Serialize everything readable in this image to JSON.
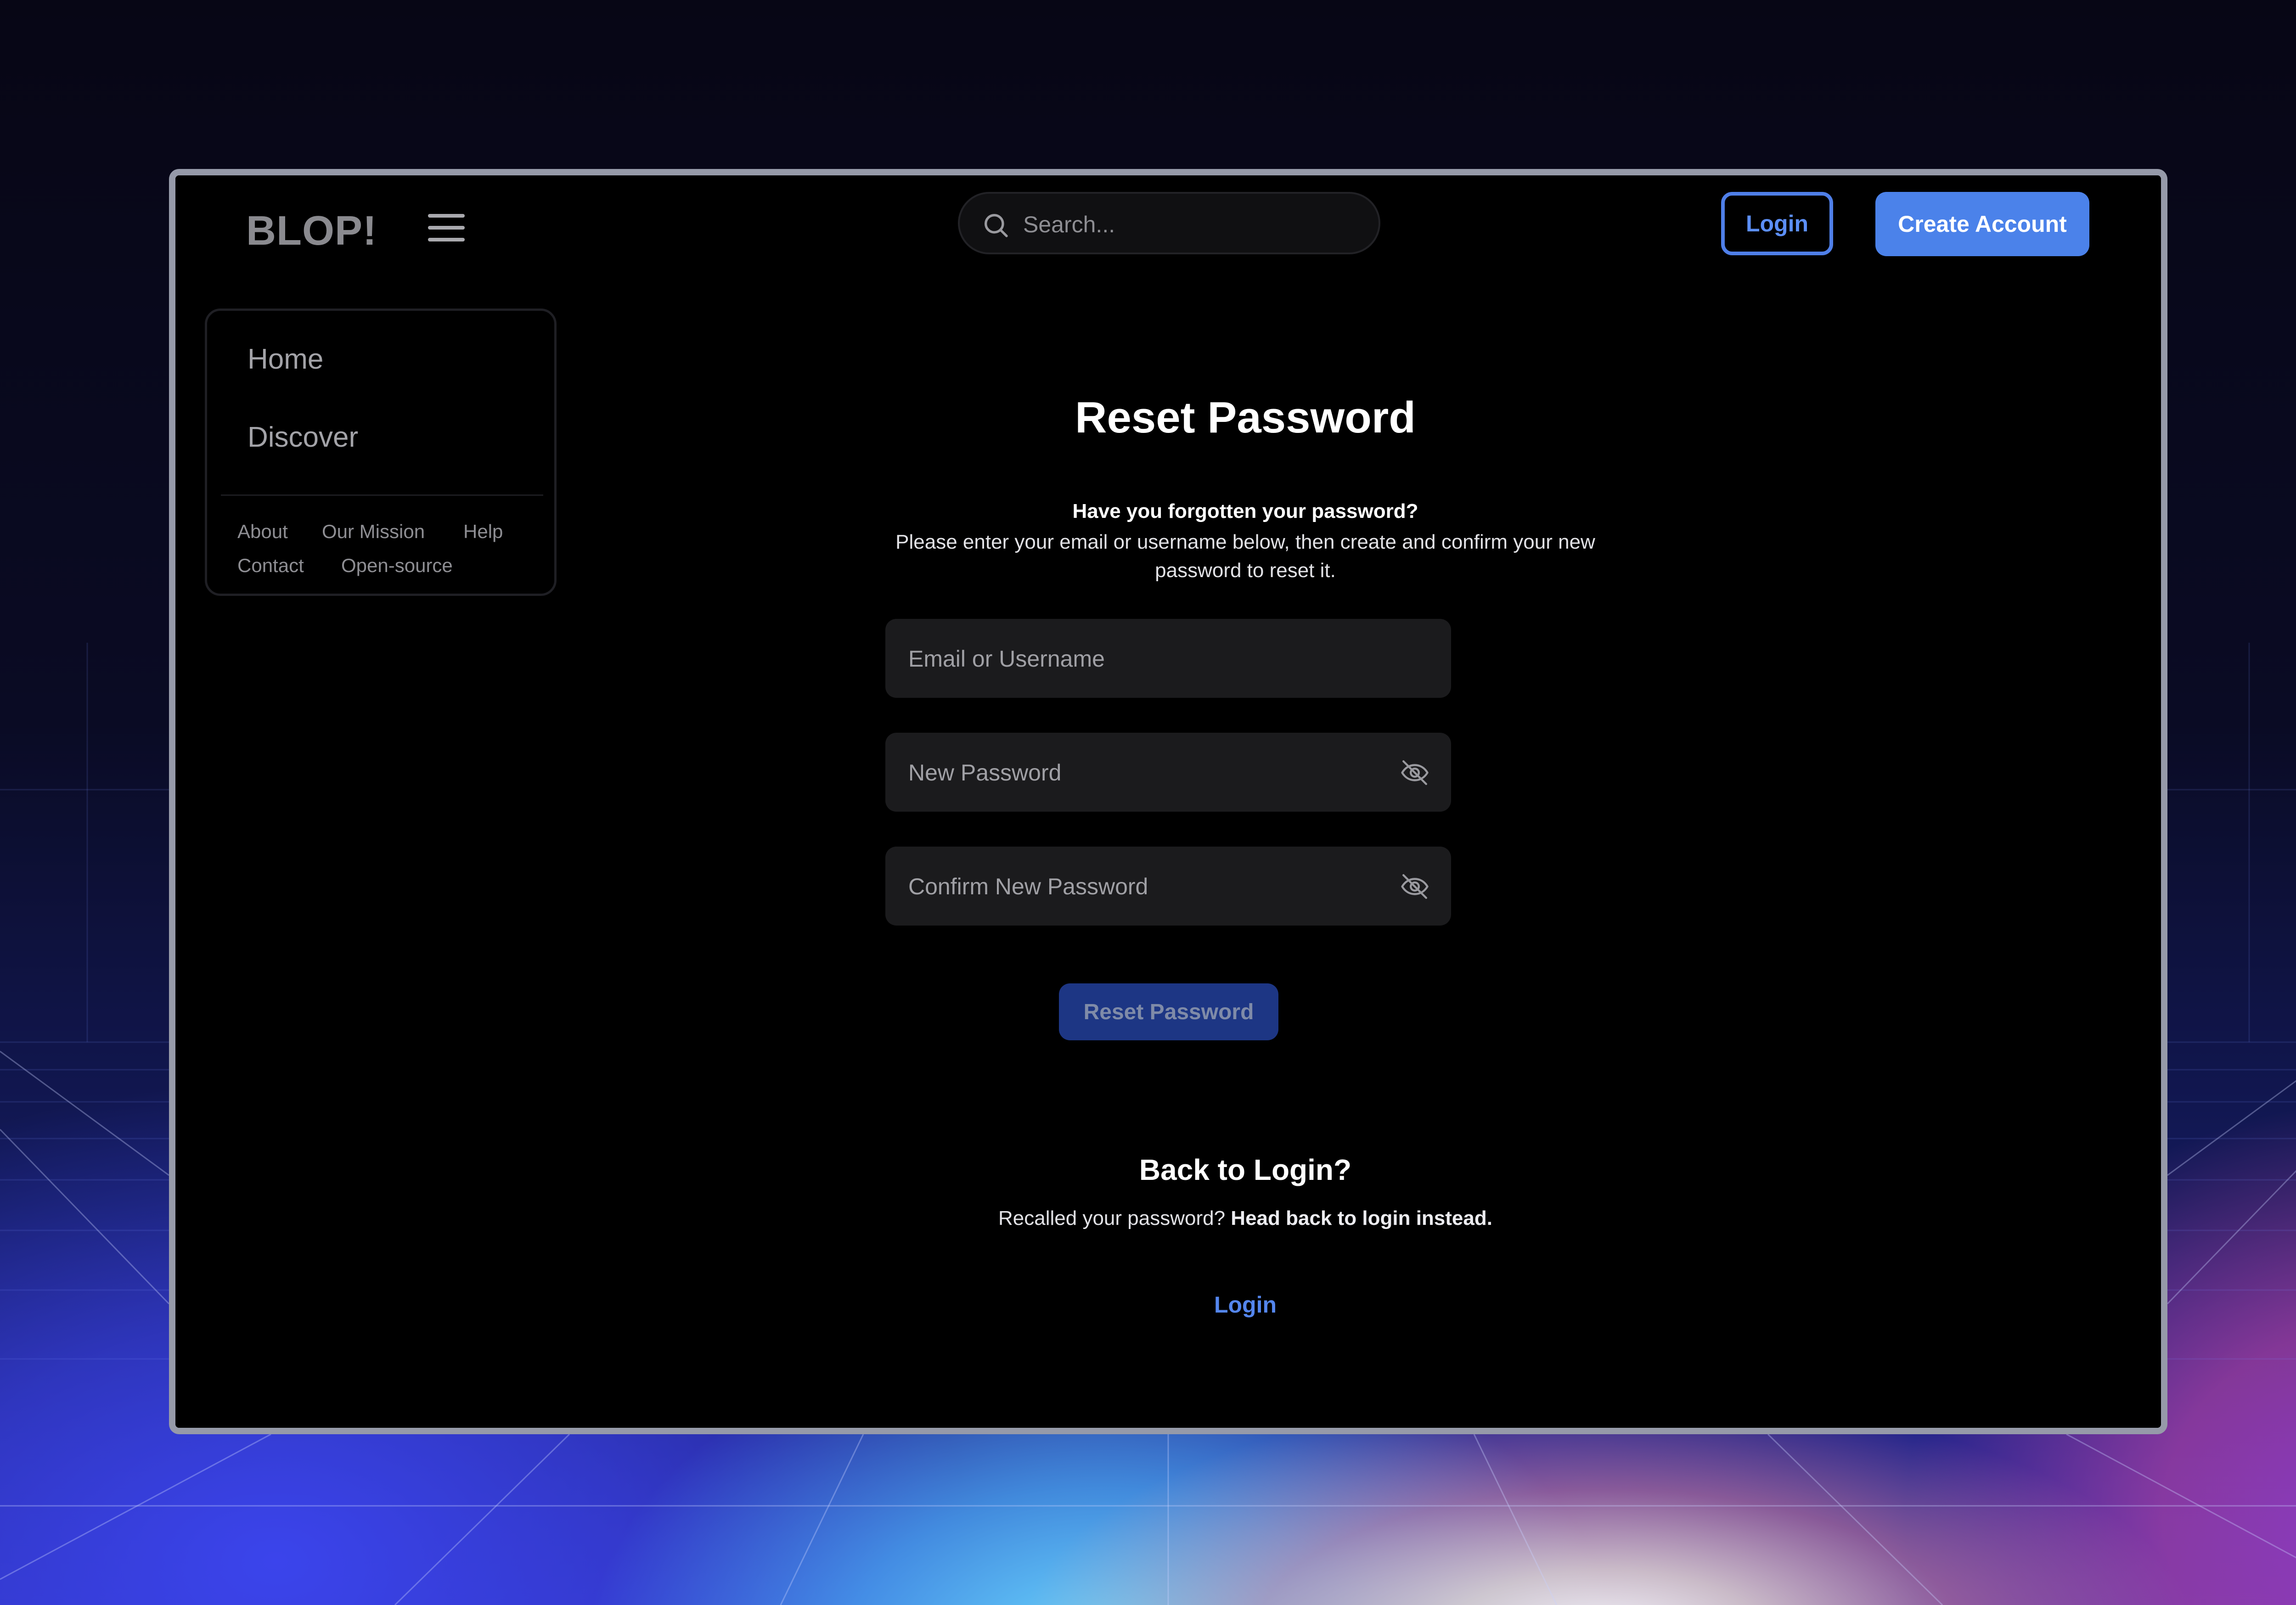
{
  "header": {
    "logo": "BLOP!",
    "search_placeholder": "Search...",
    "login_label": "Login",
    "create_account_label": "Create Account"
  },
  "sidebar": {
    "nav": [
      {
        "label": "Home"
      },
      {
        "label": "Discover"
      }
    ],
    "footer_links": [
      "About",
      "Our Mission",
      "Help",
      "Contact",
      "Open-source"
    ]
  },
  "main": {
    "title": "Reset Password",
    "intro_question": "Have you forgotten your password?",
    "intro_text": "Please enter your email or username below, then create and confirm your new password to reset it.",
    "fields": {
      "email": {
        "placeholder": "Email or Username",
        "value": ""
      },
      "new_password": {
        "placeholder": "New Password",
        "value": "",
        "icon": "eye-off-icon"
      },
      "confirm_password": {
        "placeholder": "Confirm New Password",
        "value": "",
        "icon": "eye-off-icon"
      }
    },
    "submit_label": "Reset Password",
    "back": {
      "title": "Back to Login?",
      "text": "Recalled your password?",
      "text_bold": "Head back to login instead.",
      "link": "Login"
    }
  },
  "colors": {
    "accent": "#4b82ea",
    "accent_link": "#5486ee",
    "submit_disabled_bg": "#1d3684",
    "window_bg": "#000000",
    "field_bg": "#1b1b1d"
  }
}
